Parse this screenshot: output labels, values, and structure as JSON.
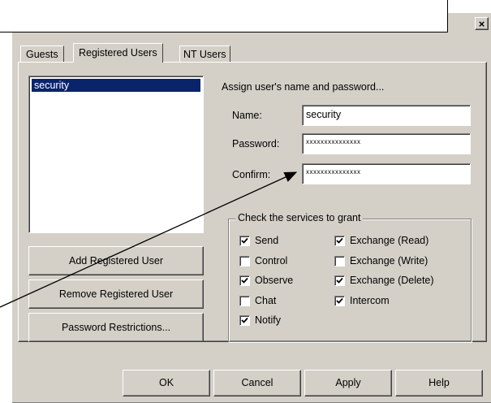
{
  "window": {
    "close_glyph": "×"
  },
  "tabs": [
    {
      "label": "Guests"
    },
    {
      "label": "Registered Users"
    },
    {
      "label": "NT Users"
    }
  ],
  "users_list": {
    "items": [
      "security"
    ],
    "selected": "security"
  },
  "left_buttons": {
    "add": "Add Registered User",
    "remove": "Remove Registered User",
    "restrictions": "Password Restrictions..."
  },
  "credentials": {
    "heading": "Assign user's name and password...",
    "name_label": "Name:",
    "name_value": "security",
    "password_label": "Password:",
    "password_value": "xxxxxxxxxxxxxxx",
    "confirm_label": "Confirm:",
    "confirm_value": "xxxxxxxxxxxxxxx"
  },
  "services": {
    "title": "Check the services to grant",
    "items": [
      {
        "label": "Send",
        "checked": true
      },
      {
        "label": "Control",
        "checked": false
      },
      {
        "label": "Observe",
        "checked": true
      },
      {
        "label": "Chat",
        "checked": false
      },
      {
        "label": "Notify",
        "checked": true
      },
      {
        "label": "Exchange (Read)",
        "checked": true
      },
      {
        "label": "Exchange (Write)",
        "checked": false
      },
      {
        "label": "Exchange (Delete)",
        "checked": true
      },
      {
        "label": "Intercom",
        "checked": true
      }
    ]
  },
  "footer": {
    "ok": "OK",
    "cancel": "Cancel",
    "apply": "Apply",
    "help": "Help"
  },
  "colors": {
    "dialog_bg": "#d4d0c8",
    "selection_bg": "#0a246a",
    "selection_text": "#ffffff"
  }
}
